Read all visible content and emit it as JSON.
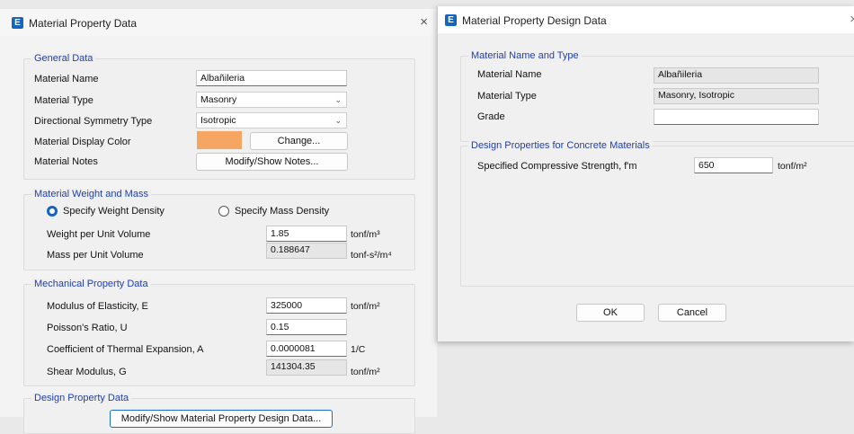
{
  "win1": {
    "title": "Material Property Data",
    "close": "×",
    "general": {
      "legend": "General Data",
      "name_label": "Material Name",
      "name_value": "Albañileria",
      "type_label": "Material Type",
      "type_value": "Masonry",
      "sym_label": "Directional Symmetry Type",
      "sym_value": "Isotropic",
      "color_label": "Material Display Color",
      "color_hex": "#f5a663",
      "change_btn": "Change...",
      "notes_label": "Material Notes",
      "notes_btn": "Modify/Show Notes..."
    },
    "weight": {
      "legend": "Material Weight and Mass",
      "radio1": "Specify Weight Density",
      "radio2": "Specify Mass Density",
      "wpuv_label": "Weight per Unit Volume",
      "wpuv_value": "1.85",
      "wpuv_unit": "tonf/m³",
      "mpuv_label": "Mass per Unit Volume",
      "mpuv_value": "0.188647",
      "mpuv_unit": "tonf-s²/m⁴"
    },
    "mech": {
      "legend": "Mechanical Property Data",
      "e_label": "Modulus of Elasticity, E",
      "e_value": "325000",
      "e_unit": "tonf/m²",
      "u_label": "Poisson's Ratio, U",
      "u_value": "0.15",
      "a_label": "Coefficient of Thermal Expansion, A",
      "a_value": "0.0000081",
      "a_unit": "1/C",
      "g_label": "Shear Modulus, G",
      "g_value": "141304.35",
      "g_unit": "tonf/m²"
    },
    "design": {
      "legend": "Design Property Data",
      "btn": "Modify/Show Material Property Design Data..."
    }
  },
  "win2": {
    "title": "Material Property Design Data",
    "close": "×",
    "nametype": {
      "legend": "Material Name and Type",
      "name_label": "Material Name",
      "name_value": "Albañileria",
      "type_label": "Material Type",
      "type_value": "Masonry, Isotropic",
      "grade_label": "Grade",
      "grade_value": ""
    },
    "concrete": {
      "legend": "Design Properties for Concrete Materials",
      "fm_label": "Specified Compressive Strength, f'm",
      "fm_value": "650",
      "fm_unit": "tonf/m²"
    },
    "ok": "OK",
    "cancel": "Cancel"
  }
}
